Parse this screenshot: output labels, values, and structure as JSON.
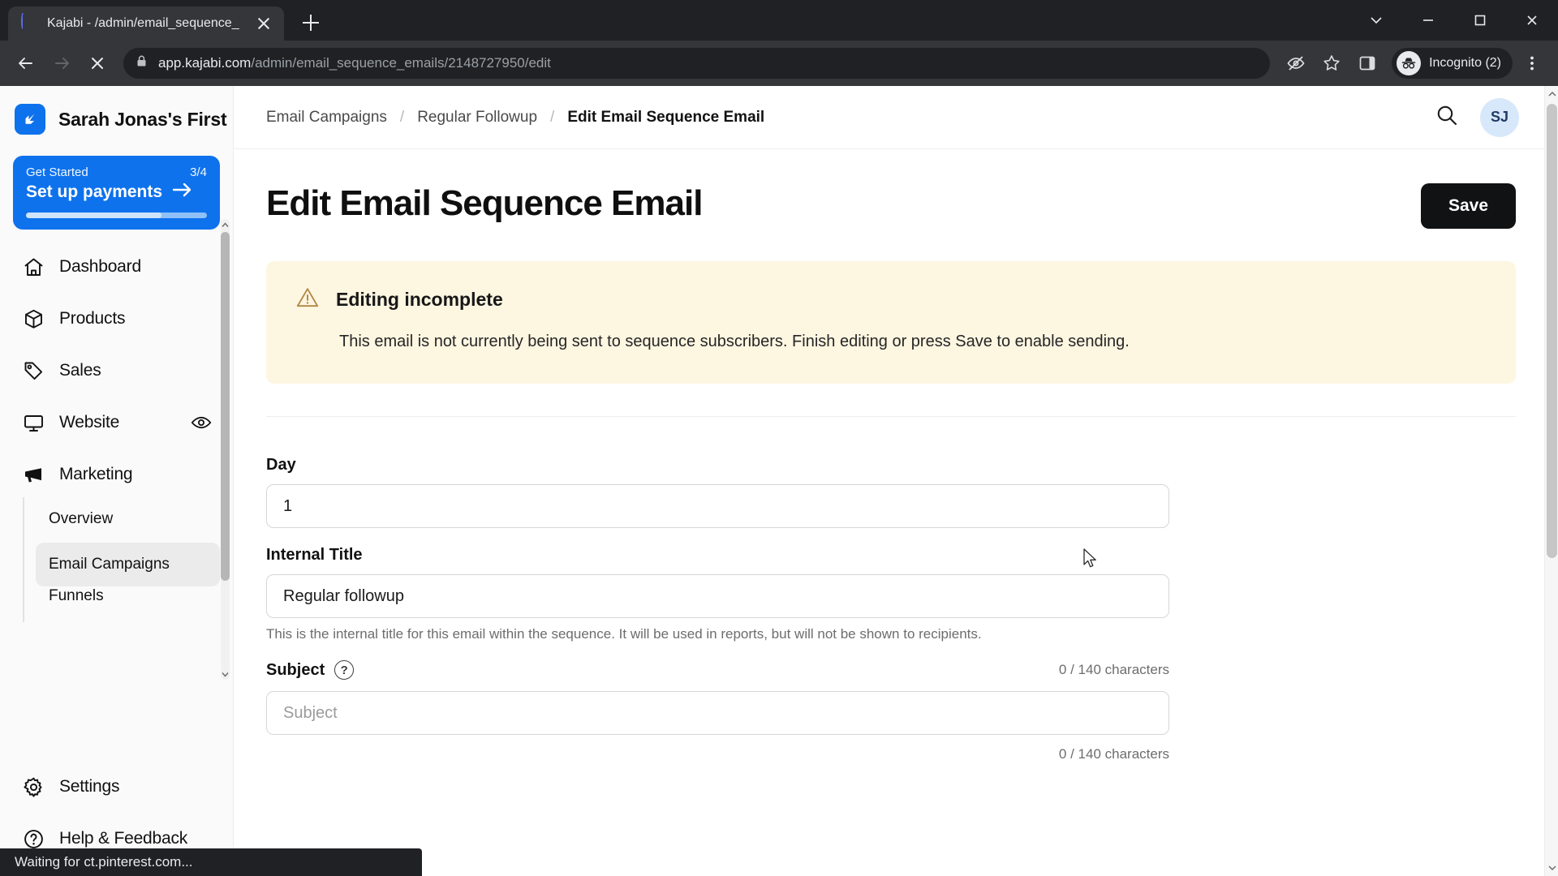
{
  "browser": {
    "tab": {
      "title": "Kajabi - /admin/email_sequence_",
      "favicon_icon": "loading-spinner-icon",
      "close_icon": "close-icon"
    },
    "new_tab_icon": "plus-icon",
    "window_controls": {
      "minimize_to_tray_icon": "chevron-down-icon",
      "minimize_icon": "minimize-icon",
      "maximize_icon": "maximize-icon",
      "close_icon": "close-icon"
    },
    "nav": {
      "back_icon": "back-arrow-icon",
      "forward_icon": "forward-arrow-icon",
      "stop_icon": "stop-loading-icon"
    },
    "omnibox": {
      "lock_icon": "lock-icon",
      "url_domain": "app.kajabi.com",
      "url_path": "/admin/email_sequence_emails/2148727950/edit",
      "url_full": "app.kajabi.com/admin/email_sequence_emails/2148727950/edit"
    },
    "toolbar_icons": {
      "tracking_protection_icon": "eye-slash-icon",
      "bookmark_icon": "star-icon",
      "side_panel_icon": "side-panel-icon",
      "menu_icon": "three-dot-menu-icon"
    },
    "profile": {
      "label": "Incognito (2)",
      "icon": "incognito-icon"
    },
    "status_text": "Waiting for ct.pinterest.com..."
  },
  "sidebar": {
    "brand": {
      "name": "Sarah Jonas's First",
      "logo_icon": "kajabi-logo-icon"
    },
    "get_started": {
      "label": "Get Started",
      "progress_text": "3/4",
      "action_label": "Set up payments",
      "arrow_icon": "arrow-right-icon",
      "progress_percent": 75,
      "accent_color": "#0e72ed"
    },
    "items": [
      {
        "label": "Dashboard",
        "icon": "home-icon"
      },
      {
        "label": "Products",
        "icon": "box-icon"
      },
      {
        "label": "Sales",
        "icon": "tag-icon"
      },
      {
        "label": "Website",
        "icon": "monitor-icon",
        "trailing_icon": "eye-icon"
      },
      {
        "label": "Marketing",
        "icon": "megaphone-icon"
      }
    ],
    "marketing_subitems": [
      {
        "label": "Overview",
        "active": false
      },
      {
        "label": "Email Campaigns",
        "active": true
      },
      {
        "label": "Funnels",
        "active": false
      }
    ],
    "bottom_items": [
      {
        "label": "Settings",
        "icon": "gear-icon"
      },
      {
        "label": "Help & Feedback",
        "icon": "question-circle-icon"
      }
    ],
    "scrollbar": {
      "up_icon": "chevron-up-icon",
      "down_icon": "chevron-down-icon"
    }
  },
  "topbar": {
    "breadcrumb": [
      {
        "label": "Email Campaigns",
        "current": false
      },
      {
        "label": "Regular Followup",
        "current": false
      },
      {
        "label": "Edit Email Sequence Email",
        "current": true
      }
    ],
    "separator": "/",
    "search_icon": "search-icon",
    "avatar_initials": "SJ"
  },
  "main": {
    "page_title": "Edit Email Sequence Email",
    "save_label": "Save",
    "alert": {
      "icon": "warning-triangle-icon",
      "title": "Editing incomplete",
      "body": "This email is not currently being sent to sequence subscribers. Finish editing or press Save to enable sending.",
      "bg_color": "#fdf6e1"
    },
    "fields": {
      "day": {
        "label": "Day",
        "value": "1"
      },
      "internal_title": {
        "label": "Internal Title",
        "value": "Regular followup",
        "help": "This is the internal title for this email within the sequence. It will be used in reports, but will not be shown to recipients."
      },
      "subject": {
        "label": "Subject",
        "help_icon": "question-mark-icon",
        "placeholder": "Subject",
        "value": "",
        "char_count": "0 / 140 characters",
        "char_count_below": "0 / 140 characters"
      }
    }
  }
}
